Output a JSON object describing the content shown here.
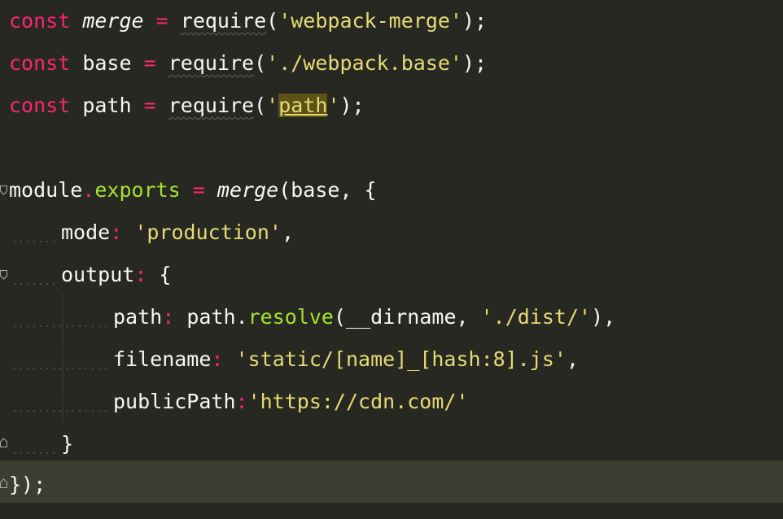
{
  "editor": {
    "theme": "monokai",
    "colors": {
      "background": "#272822",
      "current_line": "#3e3d32",
      "foreground": "#f8f8f2",
      "keyword": "#f92672",
      "string": "#e6db74",
      "function": "#a6e22e",
      "match_highlight": "#5b5218"
    },
    "lines": [
      {
        "l1_kw": "const",
        "l1_sp1": " ",
        "l1_var": "merge",
        "l1_sp2": " ",
        "l1_eq": "=",
        "l1_sp3": " ",
        "l1_req": "require",
        "l1_open": "(",
        "l1_str": "'webpack-merge'",
        "l1_close": ");"
      },
      {
        "l2_kw": "const",
        "l2_sp1": " ",
        "l2_var": "base",
        "l2_sp2": " ",
        "l2_eq": "=",
        "l2_sp3": " ",
        "l2_req": "require",
        "l2_open": "(",
        "l2_str": "'./webpack.base'",
        "l2_close": ");"
      },
      {
        "l3_kw": "const",
        "l3_sp1": " ",
        "l3_var": "path",
        "l3_sp2": " ",
        "l3_eq": "=",
        "l3_sp3": " ",
        "l3_req": "require",
        "l3_open": "(",
        "l3_q1": "'",
        "l3_match": "path",
        "l3_q2": "'",
        "l3_close": ");"
      },
      {},
      {
        "l5_mod": "module",
        "l5_dot": ".",
        "l5_exp": "exports",
        "l5_sp1": " ",
        "l5_eq": "=",
        "l5_sp2": " ",
        "l5_merge": "merge",
        "l5_rest": "(base, {"
      },
      {
        "l6_key": "mode",
        "l6_colon": ":",
        "l6_sp": " ",
        "l6_str": "'production'",
        "l6_comma": ","
      },
      {
        "l7_key": "output",
        "l7_colon": ":",
        "l7_rest": " {"
      },
      {
        "l8_key": "path",
        "l8_colon": ":",
        "l8_sp1": " ",
        "l8_obj": "path",
        "l8_dot": ".",
        "l8_fn": "resolve",
        "l8_open": "(",
        "l8_arg": "__dirname",
        "l8_comma": ", ",
        "l8_str": "'./dist/'",
        "l8_close": "),"
      },
      {
        "l9_key": "filename",
        "l9_colon": ":",
        "l9_sp": " ",
        "l9_str": "'static/[name]_[hash:8].js'",
        "l9_comma": ","
      },
      {
        "l10_key": "publicPath",
        "l10_colon": ":",
        "l10_str": "'https://cdn.com/'"
      },
      {
        "l11_brace": "}"
      },
      {
        "l12_close": "});"
      }
    ]
  }
}
